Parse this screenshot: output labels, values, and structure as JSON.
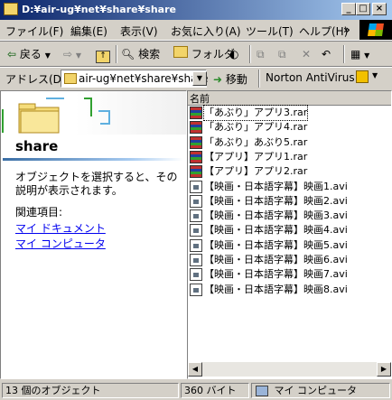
{
  "window": {
    "title": "D:¥air-ug¥net¥share¥share"
  },
  "menu": [
    "ファイル(F)",
    "編集(E)",
    "表示(V)",
    "お気に入り(A)",
    "ツール(T)",
    "ヘルプ(H)"
  ],
  "toolbar": {
    "back": "戻る",
    "search": "検索",
    "folders": "フォルダ"
  },
  "address": {
    "label": "アドレス(D)",
    "value": "air-ug¥net¥share¥share",
    "go": "移動",
    "links": "Norton AntiVirus"
  },
  "leftpane": {
    "title": "share",
    "description": "オブジェクトを選択すると、その説明が表示されます。",
    "related_label": "関連項目:",
    "links": [
      "マイ ドキュメント",
      "マイ コンピュータ"
    ]
  },
  "filelist": {
    "column_name": "名前",
    "files": [
      {
        "name": "「あぶり」アプリ3.rar",
        "type": "rar"
      },
      {
        "name": "「あぶり」アプリ4.rar",
        "type": "rar"
      },
      {
        "name": "「あぶり」あぶり5.rar",
        "type": "rar"
      },
      {
        "name": "【アプリ】アプリ1.rar",
        "type": "rar"
      },
      {
        "name": "【アプリ】アプリ2.rar",
        "type": "rar"
      },
      {
        "name": "【映画・日本語字幕】映画1.avi",
        "type": "avi"
      },
      {
        "name": "【映画・日本語字幕】映画2.avi",
        "type": "avi"
      },
      {
        "name": "【映画・日本語字幕】映画3.avi",
        "type": "avi"
      },
      {
        "name": "【映画・日本語字幕】映画4.avi",
        "type": "avi"
      },
      {
        "name": "【映画・日本語字幕】映画5.avi",
        "type": "avi"
      },
      {
        "name": "【映画・日本語字幕】映画6.avi",
        "type": "avi"
      },
      {
        "name": "【映画・日本語字幕】映画7.avi",
        "type": "avi"
      },
      {
        "name": "【映画・日本語字幕】映画8.avi",
        "type": "avi"
      }
    ]
  },
  "status": {
    "objects": "13 個のオブジェクト",
    "size": "360 バイト",
    "location": "マイ コンピュータ"
  }
}
